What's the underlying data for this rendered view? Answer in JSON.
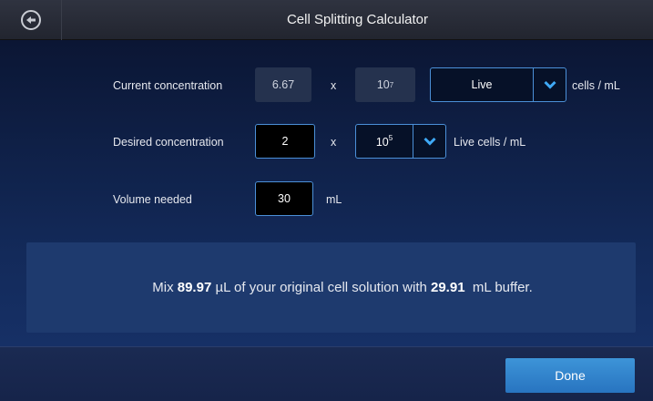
{
  "header": {
    "title": "Cell Splitting Calculator",
    "back_icon": "back-arrow-icon"
  },
  "current": {
    "label": "Current concentration",
    "mantissa": "6.67",
    "times": "x",
    "exp_base": "10",
    "exp_power": "7",
    "viability": "Live",
    "unit": "cells / mL"
  },
  "desired": {
    "label": "Desired concentration",
    "mantissa": "2",
    "times": "x",
    "exp_base": "10",
    "exp_power": "5",
    "unit": "Live cells / mL"
  },
  "volume": {
    "label": "Volume needed",
    "value": "30",
    "unit": "mL"
  },
  "result": {
    "prefix": "Mix ",
    "sample_volume": "89.97",
    "middle": " µL of your original cell solution with ",
    "buffer_volume": "29.91",
    "suffix": "  mL buffer."
  },
  "footer": {
    "done_label": "Done"
  },
  "colors": {
    "accent": "#3d94d8",
    "panel": "#1e3a6e",
    "chevron": "#3fa9f5"
  }
}
